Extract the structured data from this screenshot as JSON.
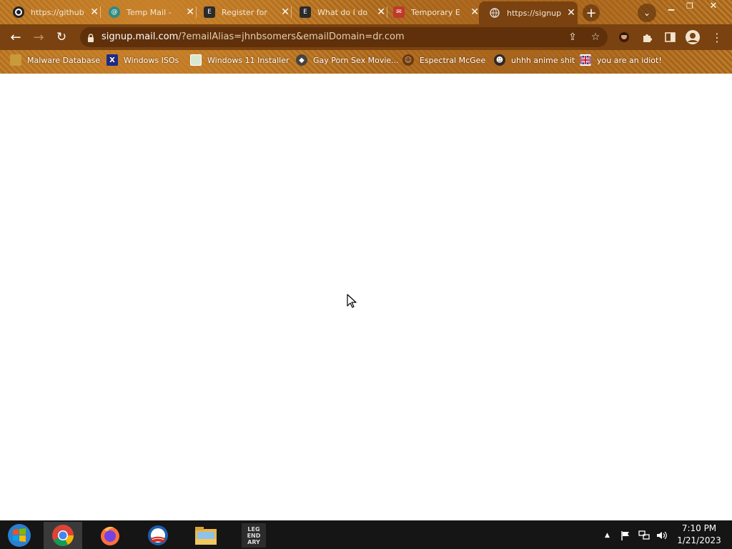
{
  "tabs": [
    {
      "title": "https://github",
      "icon": "github-icon"
    },
    {
      "title": "Temp Mail - ",
      "icon": "temp-mail-icon"
    },
    {
      "title": "Register for",
      "icon": "epic-games-icon"
    },
    {
      "title": "What do I do",
      "icon": "epic-games-icon"
    },
    {
      "title": "Temporary E",
      "icon": "temporary-email-icon"
    },
    {
      "title": "https://signup",
      "icon": "globe-icon",
      "active": true
    }
  ],
  "address_bar": {
    "host": "signup.mail.com",
    "path": "/?emailAlias=jhnbsomers&emailDomain=dr.com"
  },
  "bookmarks": [
    {
      "label": "Malware Database",
      "icon": "folder-icon"
    },
    {
      "label": "Windows ISOs",
      "icon": "x-icon"
    },
    {
      "label": "Windows 11 Installer",
      "icon": "image-icon"
    },
    {
      "label": "Gay Porn Sex Movie...",
      "icon": "site-icon"
    },
    {
      "label": "Espectral McGee",
      "icon": "character-icon"
    },
    {
      "label": "uhhh anime shit",
      "icon": "anime-icon"
    },
    {
      "label": "you are an idiot!",
      "icon": "flag-icon"
    }
  ],
  "taskbar": {
    "apps": [
      {
        "name": "start-button"
      },
      {
        "name": "chrome",
        "active": true
      },
      {
        "name": "firefox"
      },
      {
        "name": "obama"
      },
      {
        "name": "file-explorer"
      },
      {
        "name": "legendary",
        "label": "LEG\nEND\nARY"
      }
    ],
    "time": "7:10 PM",
    "date": "1/21/2023"
  },
  "colors": {
    "frame": "#b57325",
    "toolbar": "#7a4210",
    "omnibox": "#5f300a",
    "taskbar": "#151515"
  }
}
